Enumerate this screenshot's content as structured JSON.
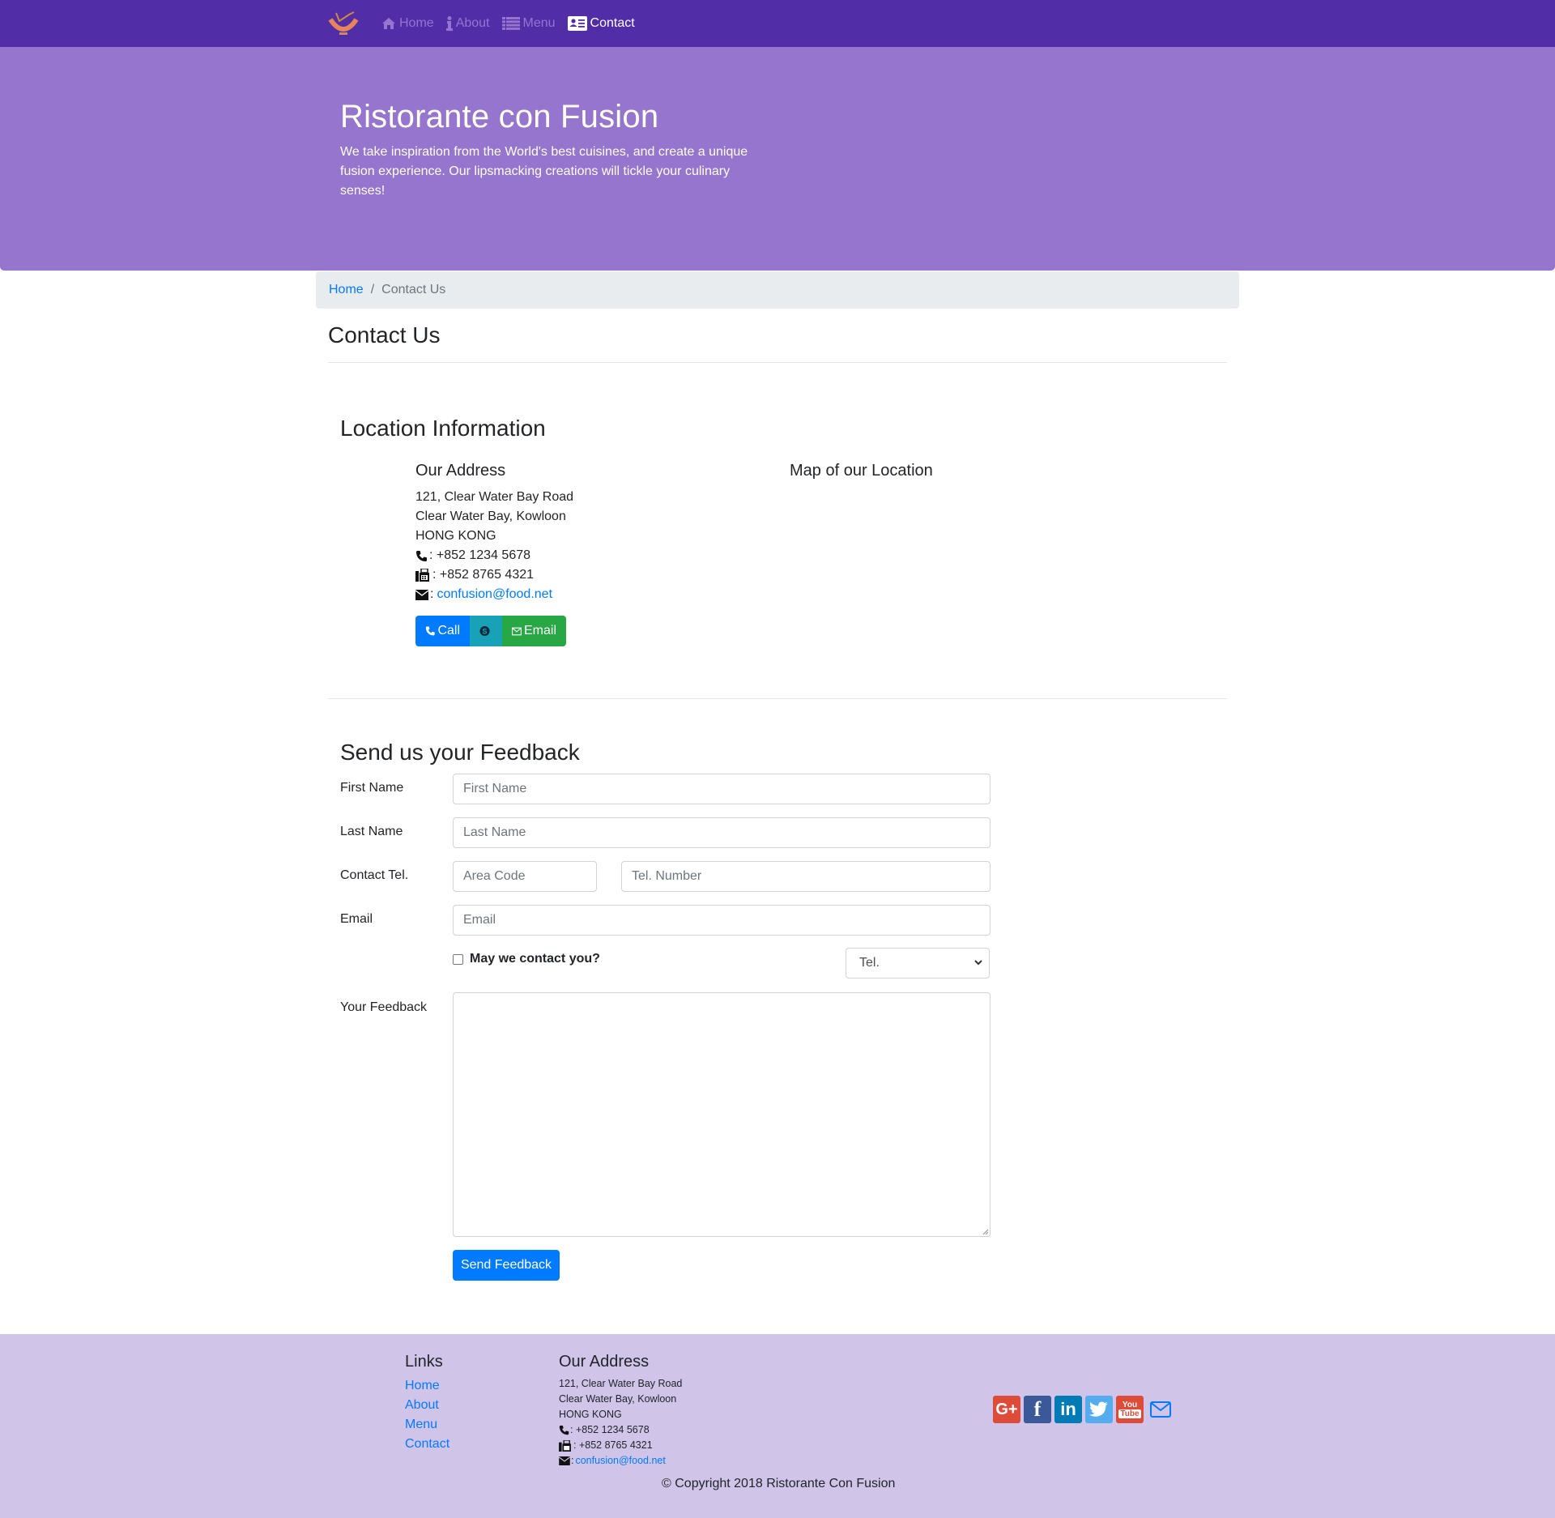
{
  "navbar": {
    "brand": "Ristorante con Fusion logo",
    "items": [
      {
        "label": "Home",
        "icon": "home-icon",
        "active": false
      },
      {
        "label": "About",
        "icon": "info-icon",
        "active": false
      },
      {
        "label": "Menu",
        "icon": "list-icon",
        "active": false
      },
      {
        "label": "Contact",
        "icon": "address-card-icon",
        "active": true
      }
    ]
  },
  "jumbotron": {
    "title": "Ristorante con Fusion",
    "text": "We take inspiration from the World's best cuisines, and create a unique fusion experience. Our lipsmacking creations will tickle your culinary senses!"
  },
  "breadcrumb": {
    "home": "Home",
    "separator": "/",
    "current": "Contact Us"
  },
  "page_title": "Contact Us",
  "location": {
    "title": "Location Information",
    "address_title": "Our Address",
    "address_lines": [
      "121, Clear Water Bay Road",
      "Clear Water Bay, Kowloon",
      "HONG KONG"
    ],
    "phone": ": +852 1234 5678",
    "fax": ": +852 8765 4321",
    "email_prefix": ":",
    "email": "confusion@food.net",
    "map_title": "Map of our Location",
    "buttons": {
      "call": "Call",
      "skype": "",
      "email": "Email"
    }
  },
  "feedback": {
    "title": "Send us your Feedback",
    "first_name": {
      "label": "First Name",
      "placeholder": "First Name",
      "value": ""
    },
    "last_name": {
      "label": "Last Name",
      "placeholder": "Last Name",
      "value": ""
    },
    "contact_tel": {
      "label": "Contact Tel.",
      "area_placeholder": "Area Code",
      "number_placeholder": "Tel. Number"
    },
    "email": {
      "label": "Email",
      "placeholder": "Email",
      "value": ""
    },
    "may_contact": {
      "label": "May we contact you?",
      "checked": false
    },
    "contact_type": {
      "selected": "Tel."
    },
    "your_feedback": {
      "label": "Your Feedback",
      "value": ""
    },
    "submit": "Send Feedback"
  },
  "footer": {
    "links_title": "Links",
    "links": [
      "Home",
      "About",
      "Menu",
      "Contact"
    ],
    "address_title": "Our Address",
    "address_lines": [
      "121, Clear Water Bay Road",
      "Clear Water Bay, Kowloon",
      "HONG KONG"
    ],
    "phone": ": +852 1234 5678",
    "fax": ": +852 8765 4321",
    "email_prefix": ":",
    "email": "confusion@food.net",
    "social": [
      {
        "name": "google-plus",
        "glyph": "G+",
        "color": "#dd4b39"
      },
      {
        "name": "facebook",
        "glyph": "f",
        "color": "#3b5998"
      },
      {
        "name": "linkedin",
        "glyph": "in",
        "color": "#007bb6"
      },
      {
        "name": "twitter",
        "glyph": "t",
        "color": "#55acee"
      },
      {
        "name": "youtube",
        "glyph": "You Tube",
        "color": "#dd4b39"
      },
      {
        "name": "mail",
        "glyph": "",
        "color": "#007bff"
      }
    ],
    "copyright": "© Copyright 2018 Ristorante Con Fusion"
  },
  "colors": {
    "primary": "#512DA8",
    "primary_light": "#9575CD",
    "footer_bg": "#D1C4E9",
    "link": "#007bff",
    "success": "#28a745",
    "info": "#17a2b8"
  }
}
